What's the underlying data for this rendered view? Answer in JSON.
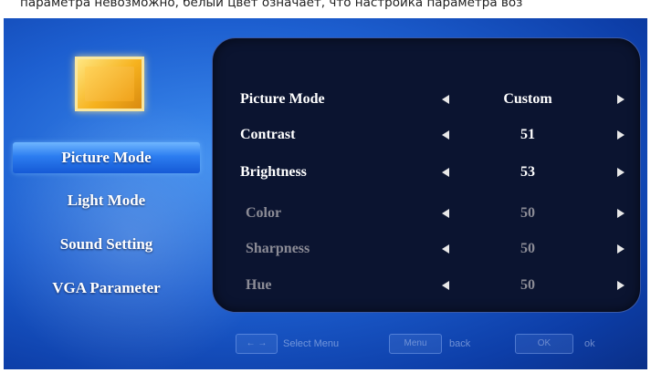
{
  "caption": "параметра невозможно, белый цвет означает, что настройка параметра воз",
  "sidebar": {
    "items": [
      {
        "label": "Picture Mode"
      },
      {
        "label": "Light Mode"
      },
      {
        "label": "Sound Setting"
      },
      {
        "label": "VGA Parameter"
      }
    ],
    "selected_index": 0,
    "icon": "picture-icon"
  },
  "settings": [
    {
      "label": "Picture Mode",
      "value": "Custom",
      "enabled": true
    },
    {
      "label": "Contrast",
      "value": "51",
      "enabled": true
    },
    {
      "label": "Brightness",
      "value": "53",
      "enabled": true
    },
    {
      "label": "Color",
      "value": "50",
      "enabled": false
    },
    {
      "label": "Sharpness",
      "value": "50",
      "enabled": false
    },
    {
      "label": "Hue",
      "value": "50",
      "enabled": false
    }
  ],
  "bottom_bar": {
    "select_key": "← →",
    "select_label": "Select Menu",
    "back_key": "Menu",
    "back_label": "back",
    "ok_key": "OK",
    "ok_label": "ok"
  },
  "colors": {
    "background": "#1d5fd0",
    "panel": "#0b1430",
    "enabled_text": "#ffffff",
    "disabled_text": "#8c8c96",
    "selection": "#2c7df0"
  }
}
